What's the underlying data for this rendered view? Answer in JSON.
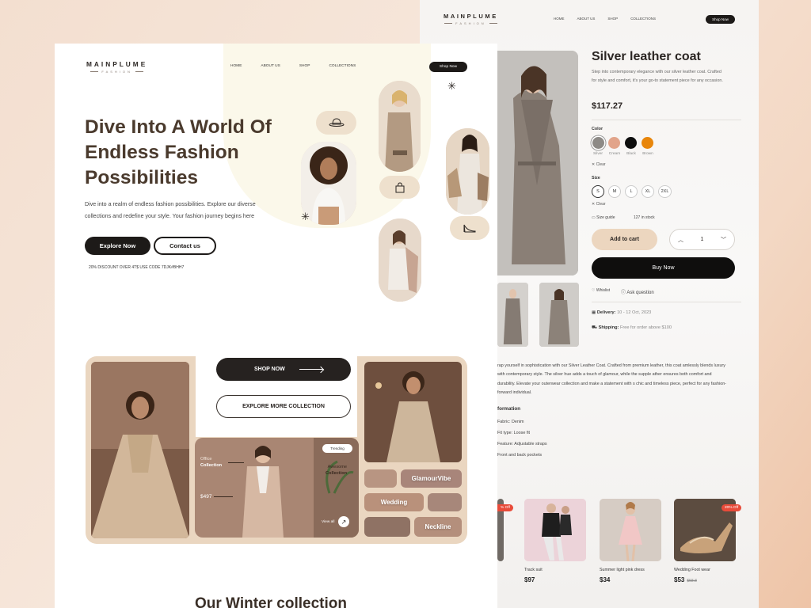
{
  "brand": {
    "name": "MAINPLUME",
    "tagline": "FASHION"
  },
  "nav": {
    "items": [
      "HOME",
      "ABOUT US",
      "SHOP",
      "COLLECTIONS"
    ],
    "cta": "Shop Now"
  },
  "hero": {
    "headline": "Dive Into A World Of Endless Fashion Possibilities",
    "body": "Dive into a realm of endless fashion possibilities. Explore our diverse collections and redefine your style. Your fashion journey begins here",
    "primary_button": "Explore Now",
    "secondary_button": "Contact us",
    "promo": "20% DISCOUNT OVER 4T$  USE CODE 7DJK#BHH7"
  },
  "collection": {
    "shop_now": "SHOP NOW",
    "explore_more": "EXPLORE MORE COLLECTION",
    "office": {
      "line1": "Office",
      "line2": "Collection",
      "price": "$497",
      "trending": "Trending",
      "awesome1": "Awesome",
      "awesome2": "Collection",
      "view_all": "View all"
    },
    "tags": [
      "GlamourVibe",
      "Wedding",
      "Neckline"
    ]
  },
  "section_heading": "Our Winter collection",
  "product": {
    "title": "Silver leather coat",
    "description": "Step into contemporary elegance with our silver leather coat. Crafted for style and comfort, it's your go-to statement piece for any occasion.",
    "price": "$117.27",
    "color_label": "Color",
    "colors": [
      {
        "name": "Silver",
        "hex": "#8d8a86"
      },
      {
        "name": "Cream",
        "hex": "#e2a48a"
      },
      {
        "name": "Black",
        "hex": "#0e0e0e"
      },
      {
        "name": "Brown",
        "hex": "#e8860b"
      }
    ],
    "clear": "Clear",
    "size_label": "Size",
    "sizes": [
      "S",
      "M",
      "L",
      "XL",
      "2XL"
    ],
    "size_guide": "Size guide",
    "stock": "127 in stock",
    "add_to_cart": "Add to cart",
    "quantity": "1",
    "buy_now": "Buy Now",
    "wishlist": "Whislist",
    "ask": "Ask question",
    "delivery_label": "Delivery:",
    "delivery_value": "10 - 12 Oct, 2023",
    "shipping_label": "Shipping:",
    "shipping_value": "Free  for order above $100",
    "long_description": "rap yourself in sophistication with our Silver Leather Coat. Crafted from premium leather, this coat amlessly blends luxury with contemporary style. The silver hue adds a touch of glamour, while the supple ather ensures both comfort and durability. Elevate your outerwear collection and make a statement with s chic and timeless piece, perfect for any fashion-forward individual.",
    "info_heading": "formation",
    "specs": [
      "Fabric: Denim",
      "Fit type: Loose fit",
      "Feature: Adjustable straps",
      "Front and back pockets"
    ]
  },
  "related": [
    {
      "badge": "% Off"
    },
    {
      "name": "Track suit",
      "price": "$97"
    },
    {
      "name": "Summer light pink dress",
      "price": "$34"
    },
    {
      "name": "Wedding Foot wear",
      "price": "$53",
      "old_price": "$58.8",
      "badge": "20% Off"
    }
  ]
}
